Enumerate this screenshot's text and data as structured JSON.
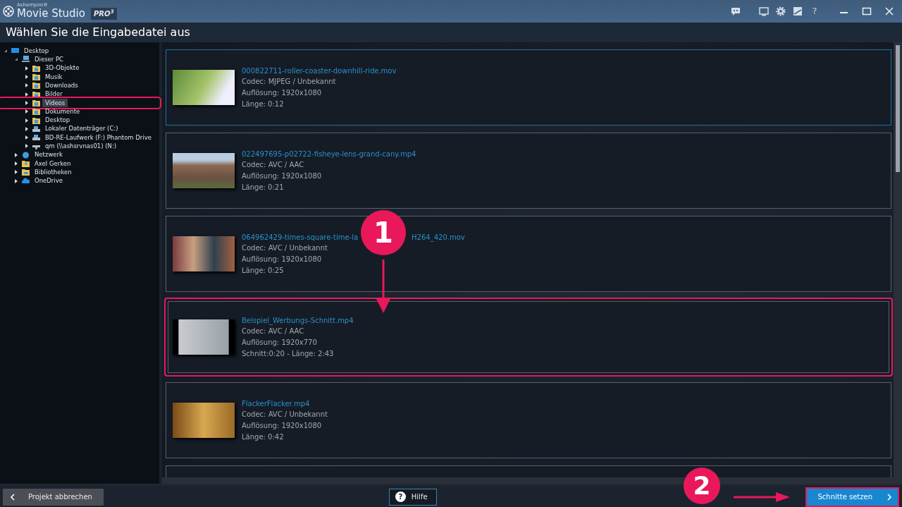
{
  "window": {
    "brand_small": "Ashampoo®",
    "title": "Movie Studio",
    "edition": "PRO",
    "edition_sup": "3"
  },
  "heading": "Wählen Sie die Eingabedatei aus",
  "tree": [
    {
      "label": "Desktop",
      "kind": "desktop",
      "expanded": true,
      "selected": false,
      "highlighted": false,
      "children": [
        {
          "label": "Dieser PC",
          "kind": "pc",
          "expanded": true,
          "selected": false,
          "highlighted": false,
          "children": [
            {
              "label": "3D-Objekte",
              "kind": "folder",
              "expanded": false,
              "selected": false,
              "highlighted": false
            },
            {
              "label": "Musik",
              "kind": "folder",
              "expanded": false,
              "selected": false,
              "highlighted": false
            },
            {
              "label": "Downloads",
              "kind": "folder",
              "expanded": false,
              "selected": false,
              "highlighted": false
            },
            {
              "label": "Bilder",
              "kind": "folder",
              "expanded": false,
              "selected": false,
              "highlighted": false
            },
            {
              "label": "Videos",
              "kind": "folder",
              "expanded": false,
              "selected": true,
              "highlighted": true
            },
            {
              "label": "Dokumente",
              "kind": "folder",
              "expanded": false,
              "selected": false,
              "highlighted": false
            },
            {
              "label": "Desktop",
              "kind": "folder",
              "expanded": false,
              "selected": false,
              "highlighted": false
            },
            {
              "label": "Lokaler Datenträger (C:)",
              "kind": "drive",
              "expanded": false,
              "selected": false,
              "highlighted": false
            },
            {
              "label": "BD-RE-Laufwerk (F:) Phantom Drive",
              "kind": "drive",
              "expanded": false,
              "selected": false,
              "highlighted": false
            },
            {
              "label": "qm (\\\\ashsrvnas01) (N:)",
              "kind": "netdrive",
              "expanded": false,
              "selected": false,
              "highlighted": false
            }
          ]
        },
        {
          "label": "Netzwerk",
          "kind": "network",
          "expanded": false,
          "selected": false,
          "highlighted": false
        },
        {
          "label": "Axel Gerken",
          "kind": "user",
          "expanded": false,
          "selected": false,
          "highlighted": false
        },
        {
          "label": "Bibliotheken",
          "kind": "library",
          "expanded": false,
          "selected": false,
          "highlighted": false
        },
        {
          "label": "OneDrive",
          "kind": "cloud",
          "expanded": false,
          "selected": false,
          "highlighted": false
        }
      ]
    }
  ],
  "files": [
    {
      "name": "000822711-roller-coaster-downhill-ride.mov",
      "codec": "Codec: MJPEG / Unbekannt",
      "resolution": "Auflösung: 1920x1080",
      "length": "Länge: 0:12",
      "selected": true,
      "highlighted": false
    },
    {
      "name": "022497695-p02722-fisheye-lens-grand-cany.mp4",
      "codec": "Codec: AVC / AAC",
      "resolution": "Auflösung: 1920x1080",
      "length": "Länge: 0:21",
      "selected": false,
      "highlighted": false
    },
    {
      "name": "064962429-times-square-time-la",
      "name_end": "H264_420.mov",
      "badge": "1",
      "codec": "Codec: AVC / Unbekannt",
      "resolution": "Auflösung: 1920x1080",
      "length": "Länge: 0:25",
      "selected": false,
      "highlighted": false
    },
    {
      "name": "Beispiel_Werbungs-Schnitt.mp4",
      "codec": "Codec: AVC / AAC",
      "resolution": "Auflösung: 1920x770",
      "length": "Schnitt:0:20 - Länge: 2:43",
      "selected": false,
      "highlighted": true
    },
    {
      "name": "FlackerFlacker.mp4",
      "codec": "Codec: AVC / Unbekannt",
      "resolution": "Auflösung: 1920x1080",
      "length": "Länge: 0:42",
      "selected": false,
      "highlighted": false
    }
  ],
  "footer": {
    "back_button": "Projekt abbrechen",
    "help_button": "Hilfe",
    "help_icon": "?",
    "step_badge": "2",
    "next_button": "Schnitte setzen",
    "next_highlighted": true
  }
}
